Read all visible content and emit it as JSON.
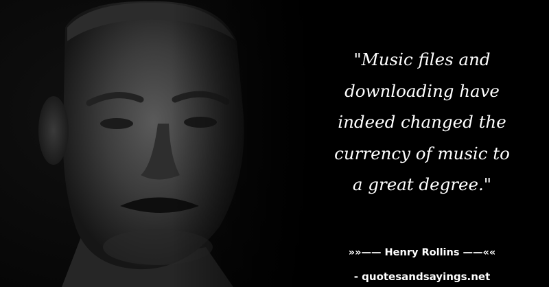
{
  "quote": {
    "lines": [
      "\"Music files and",
      "downloading have",
      "indeed changed the",
      "currency of music to",
      "a great degree.\""
    ]
  },
  "attribution": {
    "author_line": "»»—— Henry Rollins ——««",
    "source_line": "- quotesandsayings.net"
  }
}
